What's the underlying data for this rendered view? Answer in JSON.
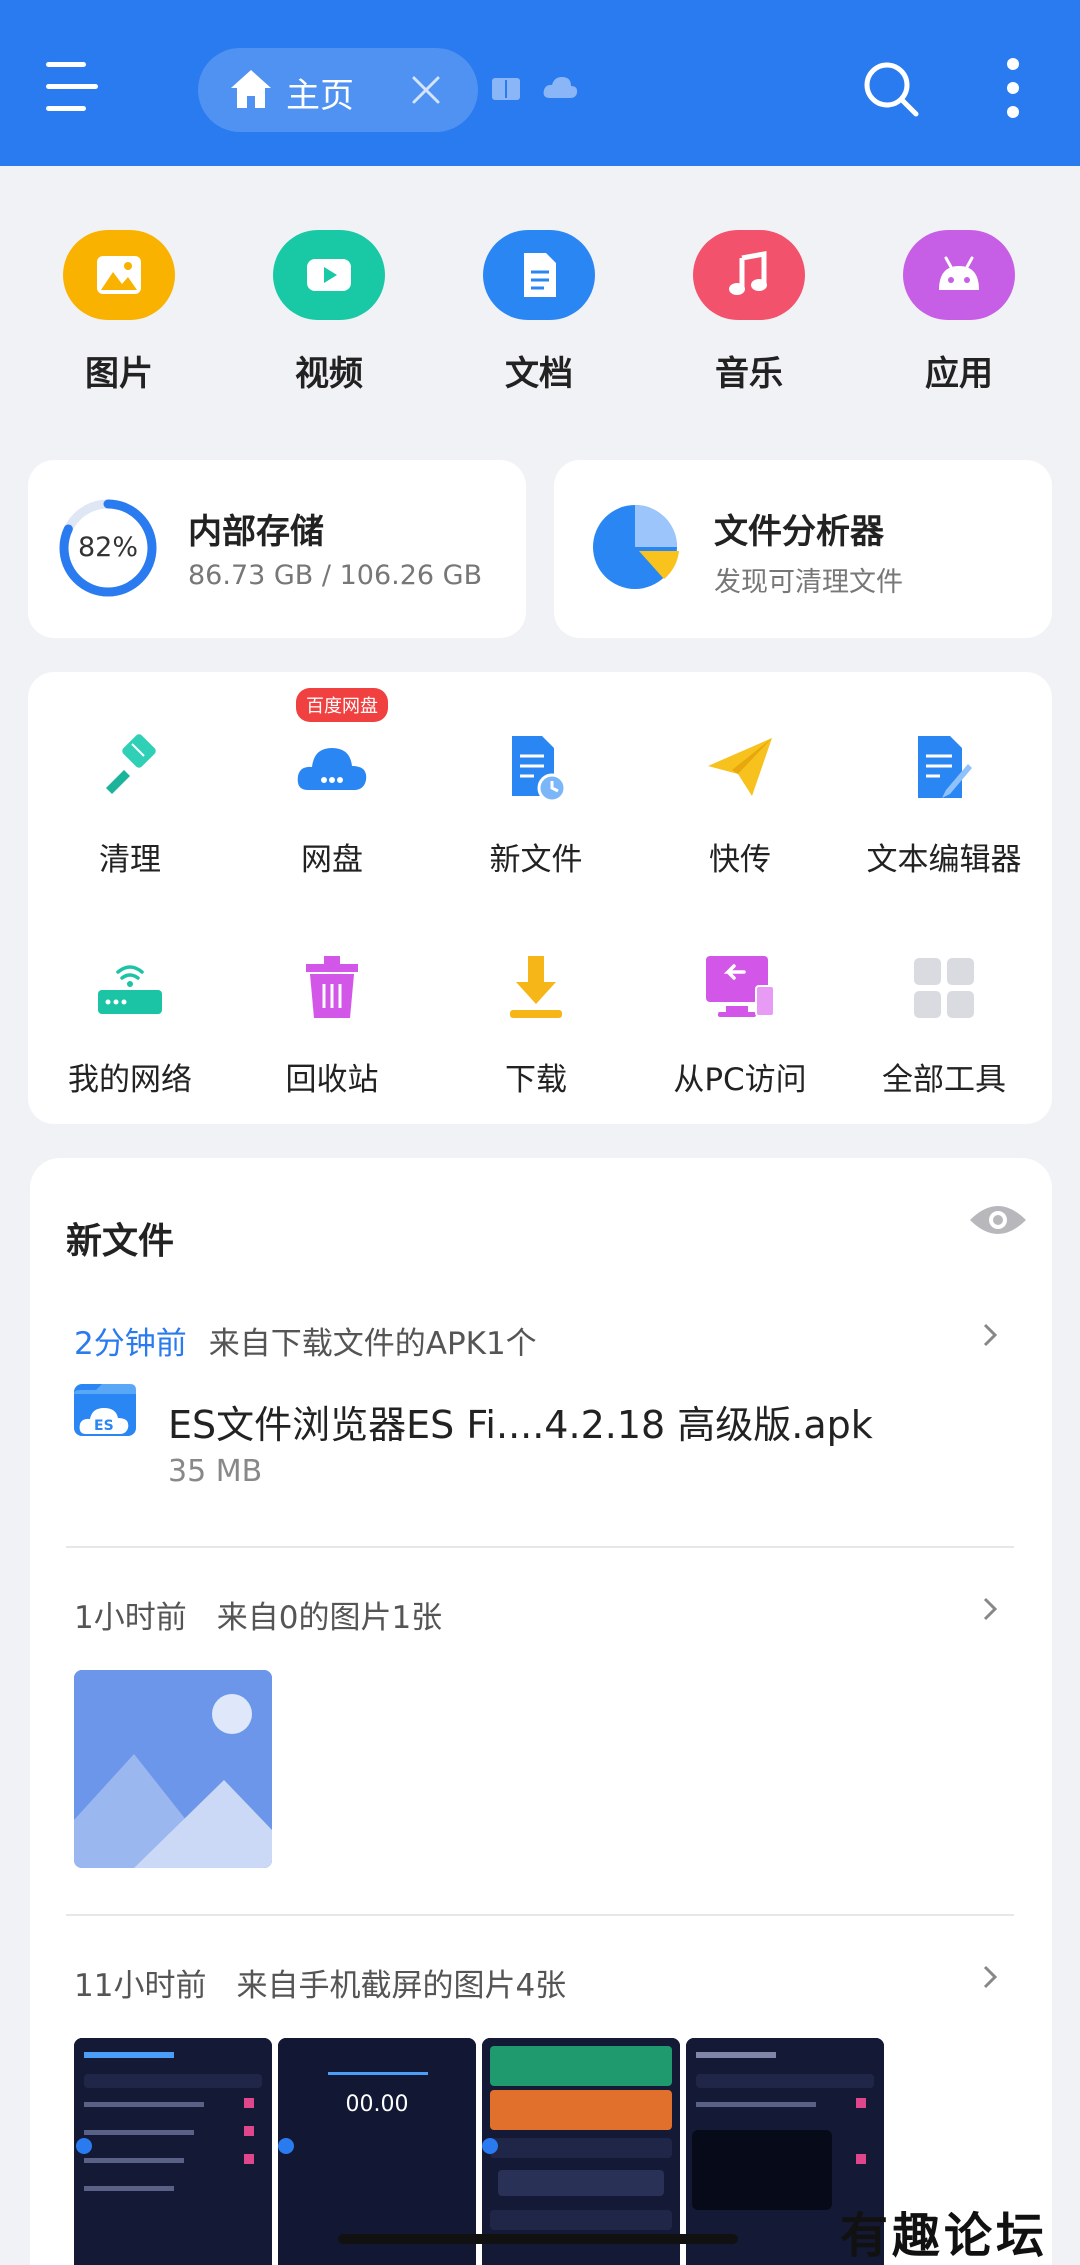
{
  "header": {
    "tab_label": "主页"
  },
  "categories": [
    {
      "label": "图片",
      "color": "#f9b200",
      "icon": "image-icon"
    },
    {
      "label": "视频",
      "color": "#19c9a5",
      "icon": "video-icon"
    },
    {
      "label": "文档",
      "color": "#2a86f3",
      "icon": "document-icon"
    },
    {
      "label": "音乐",
      "color": "#f2526b",
      "icon": "music-icon"
    },
    {
      "label": "应用",
      "color": "#c75ee6",
      "icon": "android-icon"
    }
  ],
  "storage": {
    "title": "内部存储",
    "percent_label": "82%",
    "used_fraction": 0.82,
    "usage": "86.73 GB / 106.26 GB"
  },
  "analyzer": {
    "title": "文件分析器",
    "subtitle": "发现可清理文件"
  },
  "tools": [
    {
      "label": "清理",
      "icon": "brush-icon"
    },
    {
      "label": "网盘",
      "icon": "cloud-drive-icon",
      "badge": "百度网盘"
    },
    {
      "label": "新文件",
      "icon": "new-file-icon"
    },
    {
      "label": "快传",
      "icon": "paper-plane-icon"
    },
    {
      "label": "文本编辑器",
      "icon": "text-editor-icon"
    },
    {
      "label": "我的网络",
      "icon": "router-icon"
    },
    {
      "label": "回收站",
      "icon": "trash-icon"
    },
    {
      "label": "下载",
      "icon": "download-icon"
    },
    {
      "label": "从PC访问",
      "icon": "pc-access-icon"
    },
    {
      "label": "全部工具",
      "icon": "all-tools-icon"
    }
  ],
  "recent": {
    "title": "新文件",
    "groups": [
      {
        "time": "2分钟前",
        "desc": "来自下载文件的APK1个"
      },
      {
        "time": "1小时前",
        "desc": "来自0的图片1张"
      },
      {
        "time": "11小时前",
        "desc": "来自手机截屏的图片4张"
      }
    ],
    "apk": {
      "name": "ES文件浏览器ES Fi....4.2.18 高级版.apk",
      "size": "35 MB"
    },
    "screenshot2_text": "00.00"
  },
  "watermark": "有趣论坛"
}
